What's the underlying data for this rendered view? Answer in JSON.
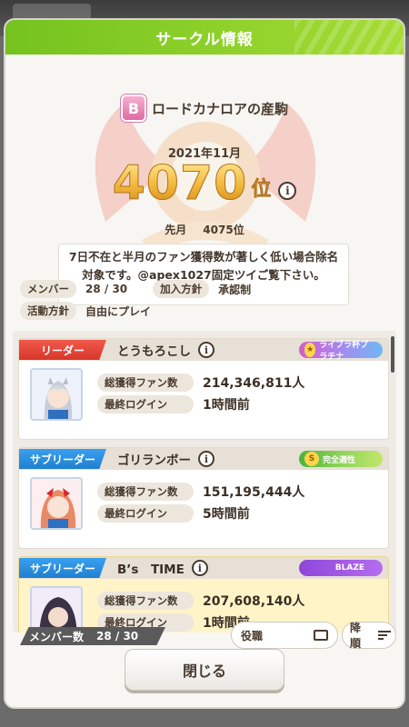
{
  "dialog": {
    "title": "サークル情報"
  },
  "circle": {
    "rank_badge": "B",
    "name": "ロードカナロアの産駒",
    "month": "2021年11月",
    "rank": "4070",
    "rank_unit": "位",
    "prev_label": "先月",
    "prev_rank": "4075位",
    "notice": "7日不在と半月のファン獲得数が著しく低い場合除名対象です。@apex1027固定ツイご覧下さい。"
  },
  "meta": {
    "members_label": "メンバー",
    "members_value": "28 / 30",
    "join_label": "加入方針",
    "join_value": "承認制",
    "activity_label": "活動方針",
    "activity_value": "自由にプレイ"
  },
  "members": [
    {
      "role": "リーダー",
      "name": "とうもろこし",
      "badge": "ライブラ杯プラチナ",
      "fans_label": "総獲得ファン数",
      "fans": "214,346,811人",
      "login_label": "最終ログイン",
      "login": "1時間前"
    },
    {
      "role": "サブリーダー",
      "name": "ゴリランボー",
      "badge": "完全適性",
      "fans_label": "総獲得ファン数",
      "fans": "151,195,444人",
      "login_label": "最終ログイン",
      "login": "5時間前"
    },
    {
      "role": "サブリーダー",
      "name": "B’s　TIME",
      "badge": "BLAZE",
      "fans_label": "総獲得ファン数",
      "fans": "207,608,140人",
      "login_label": "最終ログイン",
      "login": "1時間前"
    }
  ],
  "bottom": {
    "member_count_label": "メンバー数",
    "member_count_value": "28 / 30",
    "role_sort": "役職",
    "order_sort": "降順",
    "close": "閉じる"
  },
  "colors": {
    "header_green": "#8ed12a",
    "leader_red": "#d8352a",
    "sub_blue": "#1f7fd0",
    "rank_gold": "#f1b63a"
  }
}
